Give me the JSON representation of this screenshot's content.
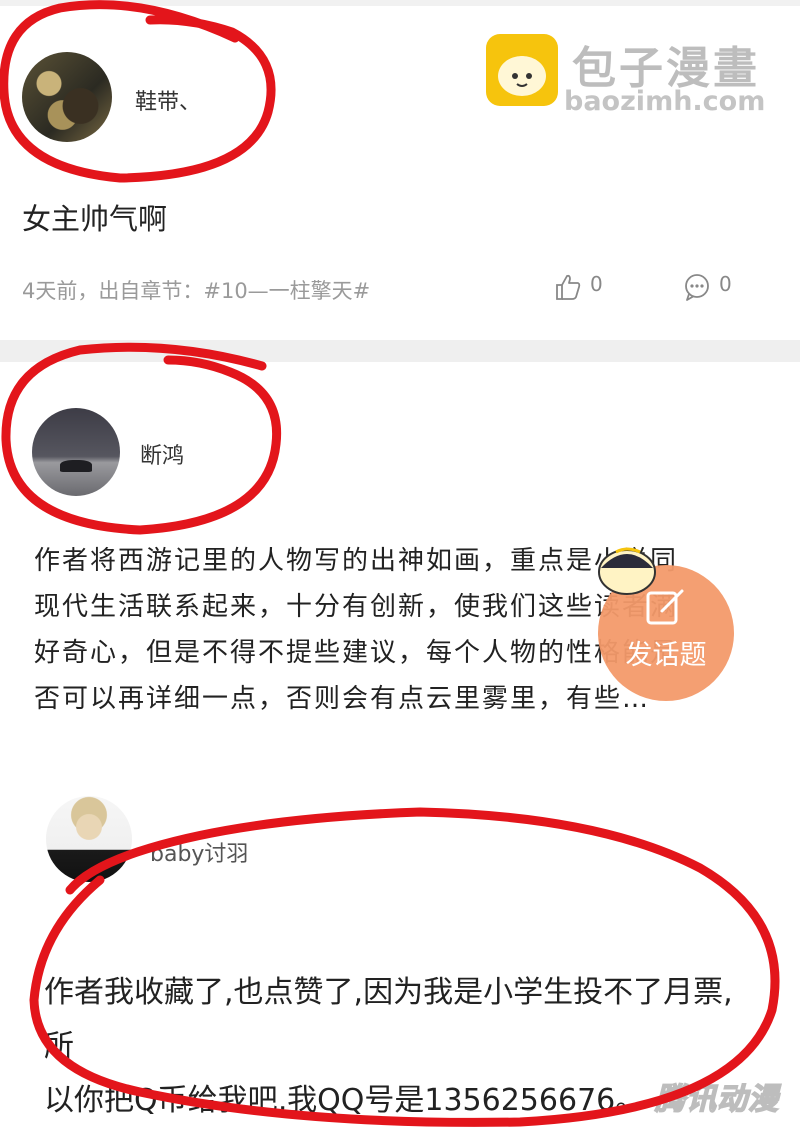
{
  "brand": {
    "title": "包子漫畫",
    "url": "baozimh.com"
  },
  "comments": [
    {
      "user": "鞋带、",
      "text": "女主帅气啊",
      "meta": "4天前，出自章节：#10—一柱擎天#",
      "likes": "0",
      "replies": "0"
    },
    {
      "user": "断鸿",
      "lines": [
        "作者将西游记里的人物写的出神如画，重点是小说同",
        "现代生活联系起来，十分有创新，使我们这些读者满",
        "好奇心，但是不得不提些建议，每个人物的性格能是",
        "否可以再详细一点，否则会有点云里雾里，有些…"
      ]
    },
    {
      "user": "baby讨羽",
      "lines": [
        "作者我收藏了,也点赞了,因为我是小学生投不了月票,所",
        "以你把Q币给我吧,我QQ号是1356256676。"
      ]
    }
  ],
  "fab": {
    "label": "发话题"
  },
  "watermark": "腾讯动漫",
  "colors": {
    "annotation": "#e3151b",
    "fab": "#f39a6a",
    "brand_icon": "#f6c40d"
  }
}
